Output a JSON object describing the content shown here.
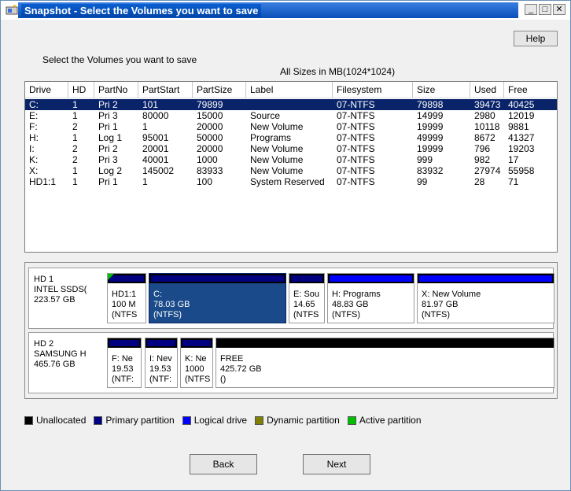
{
  "window": {
    "title": "Snapshot - Select the Volumes you want to save",
    "min_glyph": "_",
    "max_glyph": "□",
    "close_glyph": "✕"
  },
  "help_label": "Help",
  "instruction": "Select the Volumes you want to save",
  "sizes_note": "All Sizes in MB(1024*1024)",
  "table": {
    "columns": [
      "Drive",
      "HD",
      "PartNo",
      "PartStart",
      "PartSize",
      "Label",
      "Filesystem",
      "Size",
      "Used",
      "Free"
    ],
    "rows": [
      [
        "C:",
        "1",
        "Pri 2",
        "101",
        "79899",
        "",
        "07-NTFS",
        "79898",
        "39473",
        "40425"
      ],
      [
        "E:",
        "1",
        "Pri 3",
        "80000",
        "15000",
        "Source",
        "07-NTFS",
        "14999",
        "2980",
        "12019"
      ],
      [
        "F:",
        "2",
        "Pri 1",
        "1",
        "20000",
        "New Volume",
        "07-NTFS",
        "19999",
        "10118",
        "9881"
      ],
      [
        "H:",
        "1",
        "Log 1",
        "95001",
        "50000",
        "Programs",
        "07-NTFS",
        "49999",
        "8672",
        "41327"
      ],
      [
        "I:",
        "2",
        "Pri 2",
        "20001",
        "20000",
        "New Volume",
        "07-NTFS",
        "19999",
        "796",
        "19203"
      ],
      [
        "K:",
        "2",
        "Pri 3",
        "40001",
        "1000",
        "New Volume",
        "07-NTFS",
        "999",
        "982",
        "17"
      ],
      [
        "X:",
        "1",
        "Log 2",
        "145002",
        "83933",
        "New Volume",
        "07-NTFS",
        "83932",
        "27974",
        "55958"
      ],
      [
        "HD1:1",
        "1",
        "Pri 1",
        "1",
        "100",
        "System Reserved",
        "07-NTFS",
        "99",
        "28",
        "71"
      ]
    ]
  },
  "disks": [
    {
      "label_lines": [
        "HD 1",
        "INTEL SSDS(",
        "223.57 GB"
      ],
      "partitions": [
        {
          "lines": [
            "HD1:1",
            "100 M",
            "(NTFS"
          ],
          "kind": "primary",
          "active": true
        },
        {
          "lines": [
            "C:",
            "78.03 GB",
            "(NTFS)"
          ],
          "kind": "primary",
          "selected": true
        },
        {
          "lines": [
            "E: Sou",
            "14.65",
            "(NTFS"
          ],
          "kind": "primary"
        },
        {
          "lines": [
            "H: Programs",
            "48.83 GB",
            "(NTFS)"
          ],
          "kind": "logical"
        },
        {
          "lines": [
            "X: New Volume",
            "81.97 GB",
            "(NTFS)"
          ],
          "kind": "logical"
        }
      ]
    },
    {
      "label_lines": [
        "HD 2",
        "SAMSUNG H",
        "465.76 GB"
      ],
      "partitions": [
        {
          "lines": [
            "F: Ne",
            "19.53",
            "(NTF:"
          ],
          "kind": "primary"
        },
        {
          "lines": [
            "I: Nev",
            "19.53",
            "(NTF:"
          ],
          "kind": "primary"
        },
        {
          "lines": [
            "K: Ne",
            "1000",
            "(NTFS"
          ],
          "kind": "primary"
        },
        {
          "lines": [
            "FREE",
            "425.72 GB",
            "()"
          ],
          "kind": "unallocated"
        }
      ]
    }
  ],
  "legend": [
    {
      "label": "Unallocated",
      "color": "#000000"
    },
    {
      "label": "Primary partition",
      "color": "#000080"
    },
    {
      "label": "Logical drive",
      "color": "#0000ff"
    },
    {
      "label": "Dynamic partition",
      "color": "#808000"
    },
    {
      "label": "Active partition",
      "color": "#00c000"
    }
  ],
  "buttons": {
    "back": "Back",
    "next": "Next"
  }
}
